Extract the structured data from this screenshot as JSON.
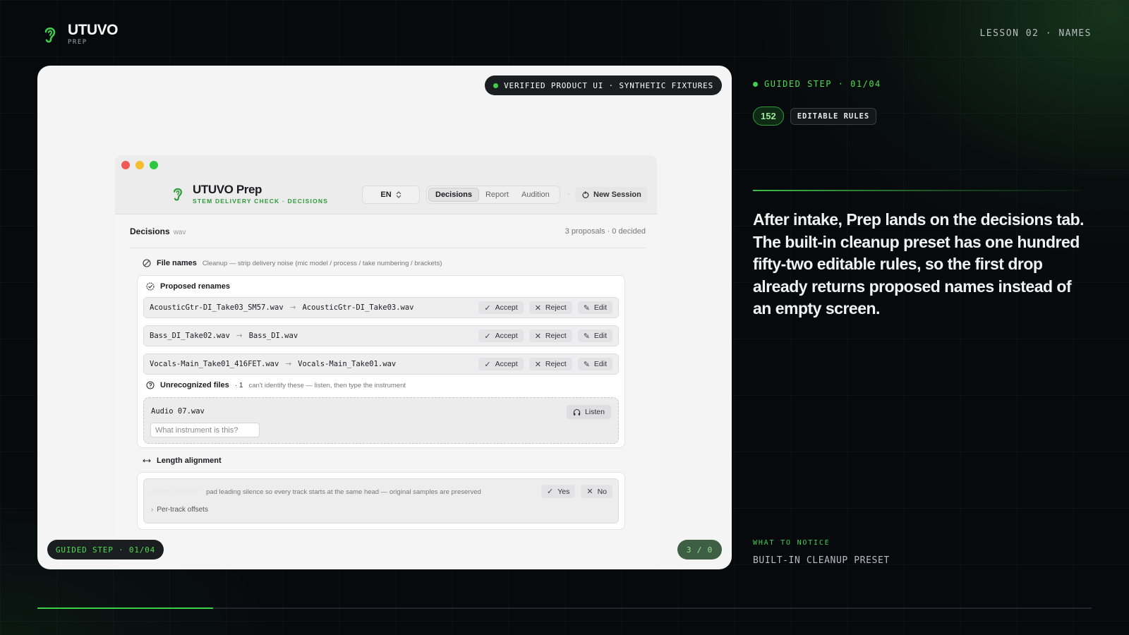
{
  "brand": {
    "name": "UTUVO",
    "sub": "PREP"
  },
  "lesson_label": "LESSON 02 · NAMES",
  "card": {
    "verified_label": "VERIFIED PRODUCT UI · SYNTHETIC FIXTURES",
    "step_label": "GUIDED STEP · 01/04",
    "counter_label": "3 / 0"
  },
  "app": {
    "title": "UTUVO Prep",
    "subtitle": "STEM DELIVERY CHECK · DECISIONS",
    "language": "EN",
    "tabs": [
      {
        "label": "Decisions",
        "active": true
      },
      {
        "label": "Report",
        "active": false
      },
      {
        "label": "Audition",
        "active": false
      }
    ],
    "separator": "·",
    "new_session_label": "New Session",
    "decisions": {
      "title": "Decisions",
      "format": "wav",
      "count": "3 proposals · 0 decided"
    },
    "file_names": {
      "label": "File names",
      "description": "Cleanup — strip delivery noise (mic model / process / take numbering / brackets)"
    },
    "proposed": {
      "label": "Proposed renames",
      "rows": [
        {
          "from": "AcousticGtr-DI_Take03_SM57.wav",
          "to": "AcousticGtr-DI_Take03.wav"
        },
        {
          "from": "Bass_DI_Take02.wav",
          "to": "Bass_DI.wav"
        },
        {
          "from": "Vocals-Main_Take01_416FET.wav",
          "to": "Vocals-Main_Take01.wav"
        }
      ],
      "arrow": "→",
      "accept_label": "Accept",
      "reject_label": "Reject",
      "edit_label": "Edit"
    },
    "unrecognized": {
      "label": "Unrecognized files",
      "count": "· 1",
      "hint": "can't identify these — listen, then type the instrument",
      "file": "Audio 07.wav",
      "listen_label": "Listen",
      "placeholder": "What instrument is this?"
    },
    "length": {
      "label": "Length alignment",
      "question": "Align heads?",
      "description": "pad leading silence so every track starts at the same head — original samples are preserved",
      "yes_label": "Yes",
      "no_label": "No",
      "offsets_label": "Per-track offsets"
    }
  },
  "right": {
    "step_label": "GUIDED STEP · 01/04",
    "rule_count": "152",
    "rules_label": "EDITABLE RULES",
    "headline": "After intake, Prep lands on the decisions tab. The built-in cleanup preset has one hundred fifty-two editable rules, so the first drop already returns proposed names instead of an empty screen.",
    "notice_label": "WHAT TO NOTICE",
    "notice_value": "BUILT-IN CLEANUP PRESET"
  },
  "progress": {
    "fraction": 0.167
  },
  "colors": {
    "accent": "#3dcf45",
    "background": "#070a0d",
    "card": "#f4f4f4"
  }
}
